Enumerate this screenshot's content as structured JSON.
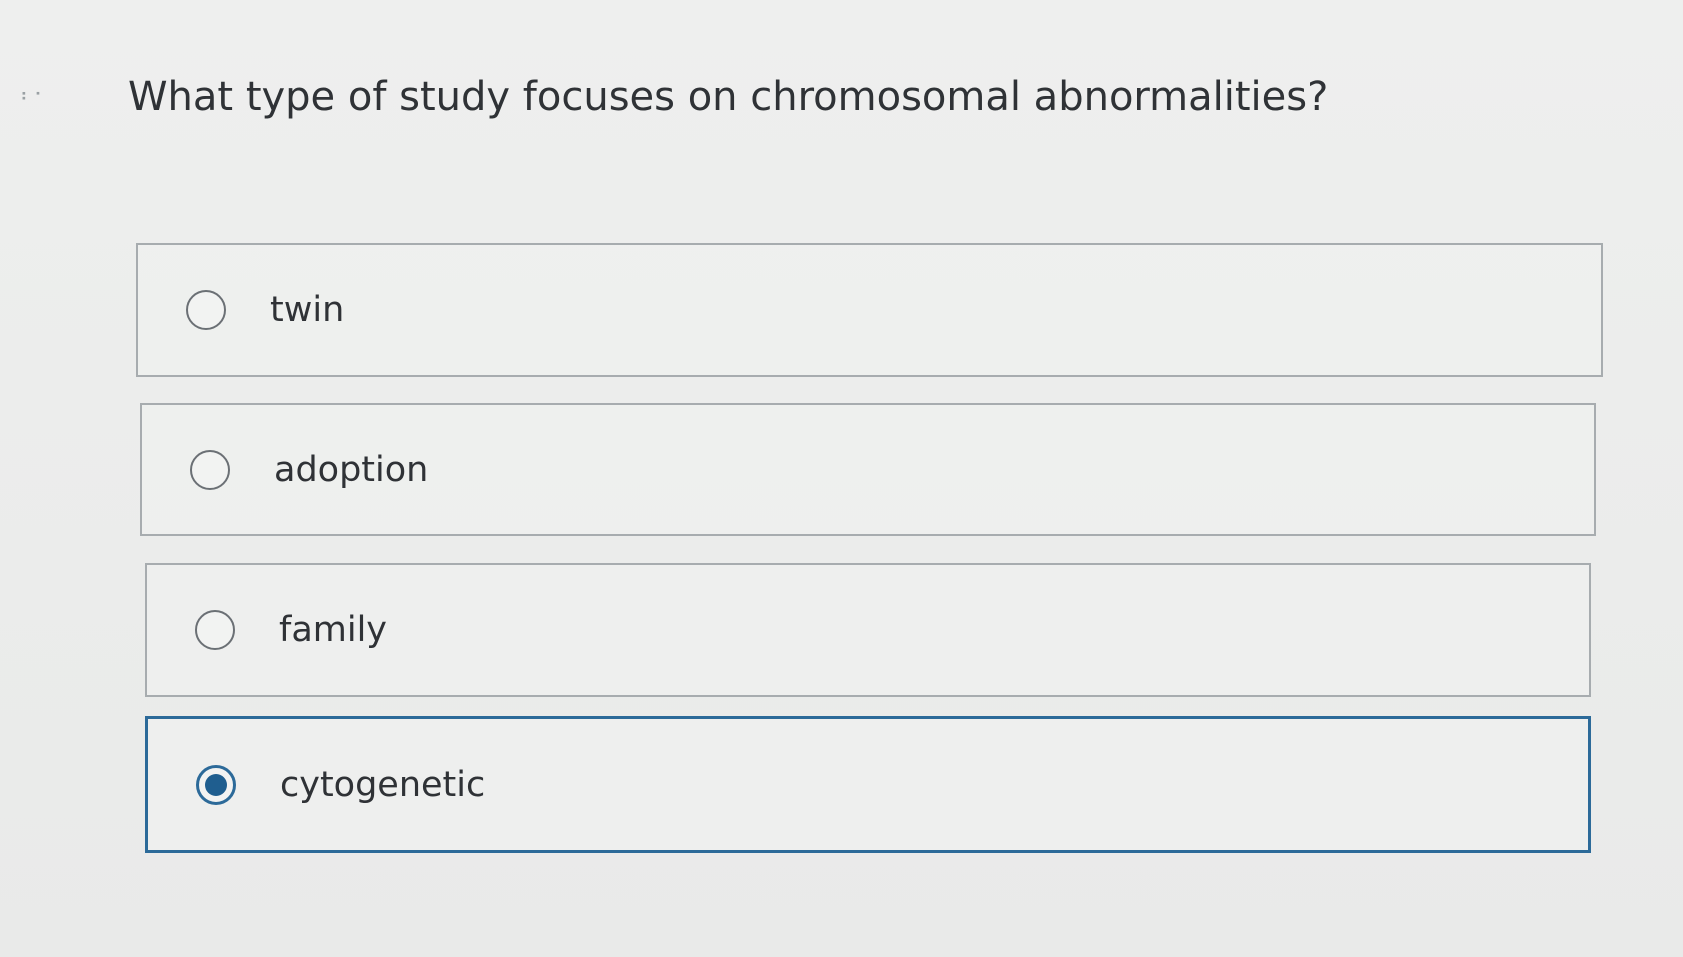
{
  "question": {
    "text": "What type of study focuses on chromosomal abnormalities?"
  },
  "choices": [
    {
      "label": "twin",
      "selected": false
    },
    {
      "label": "adoption",
      "selected": false
    },
    {
      "label": "family",
      "selected": false
    },
    {
      "label": "cytogenetic",
      "selected": true
    }
  ],
  "colors": {
    "selected_accent": "#1f5e8f",
    "border": "#a7acaf",
    "background": "#ecedec",
    "text": "#2f3236"
  },
  "icons": {
    "drag_handle": "drag-handle-icon",
    "radio_unselected": "radio-empty-icon",
    "radio_selected": "radio-filled-icon"
  }
}
